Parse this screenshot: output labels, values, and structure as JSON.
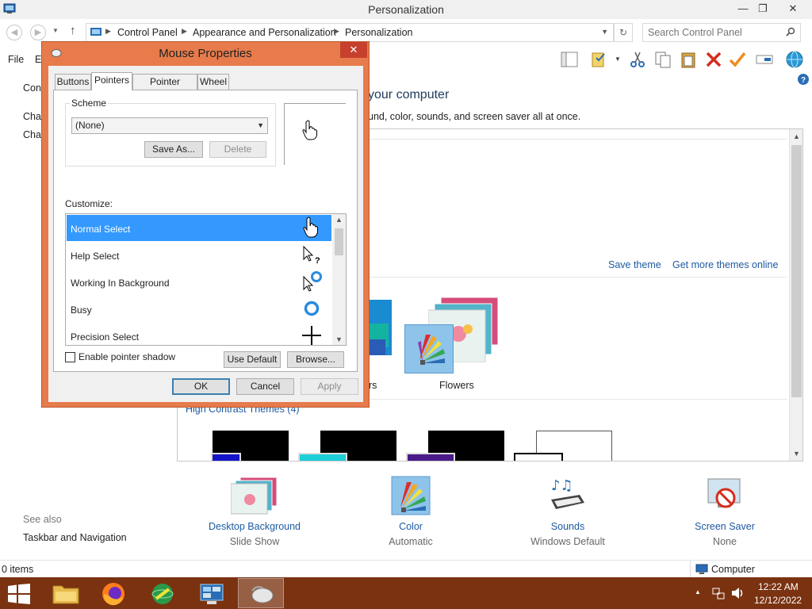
{
  "window": {
    "title": "Personalization",
    "minimize": "—",
    "maximize": "❐",
    "close": "✕"
  },
  "address": {
    "crumbs": [
      "Control Panel",
      "Appearance and Personalization",
      "Personalization"
    ],
    "search_placeholder": "Search Control Panel"
  },
  "menu": {
    "file": "File",
    "edit": "Ec"
  },
  "left_nav": {
    "items": [
      "Contr",
      "Char",
      "Char"
    ],
    "see_also": "See also",
    "taskbar_link": "Taskbar and Navigation"
  },
  "main": {
    "heading": "your computer",
    "subheading": "und, color, sounds, and screen saver all at once.",
    "save_theme": "Save theme",
    "get_more_themes": "Get more themes online",
    "themes": [
      {
        "label": "ors"
      },
      {
        "label": "Flowers"
      }
    ],
    "high_contrast_label": "High Contrast Themes (4)"
  },
  "customization": [
    {
      "label": "Desktop Background",
      "sub": "Slide Show"
    },
    {
      "label": "Color",
      "sub": "Automatic"
    },
    {
      "label": "Sounds",
      "sub": "Windows Default"
    },
    {
      "label": "Screen Saver",
      "sub": "None"
    }
  ],
  "status": {
    "items": "0 items",
    "location": "Computer"
  },
  "taskbar": {
    "time": "12:22 AM",
    "date": "12/12/2022"
  },
  "dialog": {
    "title": "Mouse Properties",
    "close": "✕",
    "tabs": [
      "Buttons",
      "Pointers",
      "Pointer Options",
      "Wheel"
    ],
    "active_tab": "Pointers",
    "scheme_label": "Scheme",
    "scheme_value": "(None)",
    "save_as": "Save As...",
    "delete": "Delete",
    "customize_label": "Customize:",
    "cursors": [
      {
        "name": "Normal Select",
        "icon": "hand-cursor-icon"
      },
      {
        "name": "Help Select",
        "icon": "help-cursor-icon"
      },
      {
        "name": "Working In Background",
        "icon": "working-cursor-icon"
      },
      {
        "name": "Busy",
        "icon": "busy-cursor-icon"
      },
      {
        "name": "Precision Select",
        "icon": "crosshair-cursor-icon"
      }
    ],
    "selected_cursor": "Normal Select",
    "shadow_label": "Enable pointer shadow",
    "shadow_checked": false,
    "use_default": "Use Default",
    "browse": "Browse...",
    "ok": "OK",
    "cancel": "Cancel",
    "apply": "Apply"
  },
  "colors": {
    "dialog_frame": "#e77b4b",
    "taskbar": "#7a3210",
    "selection": "#3399ff",
    "link": "#1e5aa0"
  }
}
